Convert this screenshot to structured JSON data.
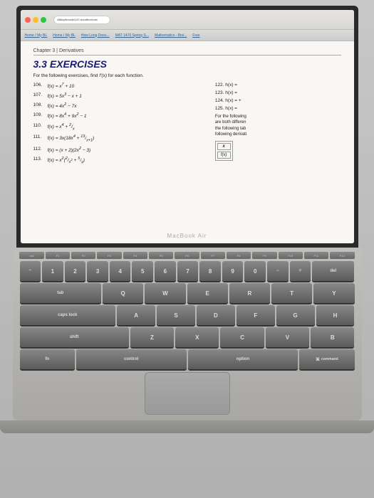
{
  "browser": {
    "tabs": [
      "MAT 1470 Spring S..."
    ],
    "address": "d3lbxy9mor4e147.cloudfront.net",
    "nav_links": [
      "Home / My BL",
      "Home / My BL",
      "How Long Does...",
      "MAT 1470 Spring S...",
      "Mathematics - Biol...",
      "Free"
    ]
  },
  "page": {
    "chapter_label": "Chapter 3 | Derivatives",
    "section_title": "3.3 EXERCISES",
    "intro": "For the following exercises, find  f'(x)  for each function.",
    "exercises": [
      {
        "num": "106.",
        "expr": "f(x) = x⁷ + 10"
      },
      {
        "num": "107.",
        "expr": "f(x) = 5x³ − x + 1"
      },
      {
        "num": "108.",
        "expr": "f(x) = 4x² − 7x"
      },
      {
        "num": "109.",
        "expr": "f(x) = 8x⁴ + 9x² − 1"
      },
      {
        "num": "110.",
        "expr": "f(x) = x⁴ + 2/x"
      },
      {
        "num": "111.",
        "expr": "f(x) = 3x(18x⁴ + 13/(x+1))"
      },
      {
        "num": "112.",
        "expr": "f(x) = (x + 2)(2x² − 3)"
      },
      {
        "num": "113.",
        "expr": "f(x) = x²(2/x² + 5/x)"
      }
    ],
    "right_column": {
      "items": [
        {
          "num": "122.",
          "expr": "h(x) ="
        },
        {
          "num": "123.",
          "expr": "h(x) ="
        },
        {
          "num": "124.",
          "expr": "h(x) = +"
        },
        {
          "num": "125.",
          "expr": "h(x) ="
        }
      ],
      "note": "For the following\nare both differen\nthe following tab\nfollowing derivati",
      "table_headers": [
        "x",
        "f(x)"
      ]
    }
  },
  "keyboard": {
    "fn_keys": [
      "esc",
      "F1",
      "F2",
      "F3",
      "F4",
      "F5",
      "F6",
      "F7",
      "F8",
      "F9",
      "F10",
      "F11",
      "F12"
    ],
    "num_keys": [
      "~`",
      "1",
      "2",
      "3",
      "4",
      "5",
      "6",
      "7",
      "8",
      "9",
      "0",
      "-",
      "=",
      "delete"
    ],
    "row1": [
      "tab",
      "Q",
      "W",
      "E",
      "R",
      "T",
      "Y"
    ],
    "row2": [
      "caps lock",
      "A",
      "S",
      "D",
      "F",
      "G",
      "H"
    ],
    "row3": [
      "shift",
      "Z",
      "X",
      "C",
      "V",
      "B"
    ],
    "row4_labels": [
      "fn",
      "control",
      "option",
      "command"
    ],
    "macbook_label": "MacBook Air"
  }
}
